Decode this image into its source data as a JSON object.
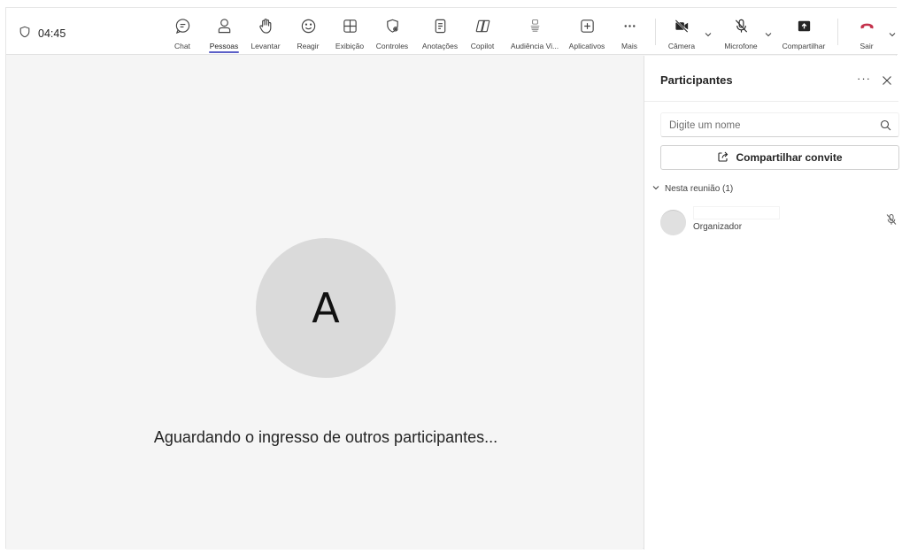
{
  "toolbar": {
    "timer": "04:45",
    "items": [
      {
        "label": "Chat",
        "icon": "chat-icon"
      },
      {
        "label": "Pessoas",
        "icon": "people-icon"
      },
      {
        "label": "Levantar",
        "icon": "raise-hand-icon"
      },
      {
        "label": "Reagir",
        "icon": "react-icon"
      },
      {
        "label": "Exibição",
        "icon": "view-icon"
      },
      {
        "label": "Controles",
        "icon": "controls-icon"
      },
      {
        "label": "Anotações",
        "icon": "notes-icon"
      },
      {
        "label": "Copilot",
        "icon": "copilot-icon"
      },
      {
        "label": "Audiência Vi...",
        "icon": "audience-icon"
      },
      {
        "label": "Aplicativos",
        "icon": "apps-icon"
      },
      {
        "label": "Mais",
        "icon": "more-icon"
      }
    ],
    "camera": "Câmera",
    "microphone": "Microfone",
    "share": "Compartilhar",
    "leave": "Sair"
  },
  "stage": {
    "avatar_initial": "A",
    "waiting_text": "Aguardando o ingresso de outros participantes..."
  },
  "panel": {
    "title": "Participantes",
    "more": "···",
    "search_placeholder": "Digite um nome",
    "share_invite": "Compartilhar convite",
    "section_label": "Nesta reunião (1)",
    "participants": [
      {
        "name": "",
        "role": "Organizador",
        "muted": true
      }
    ]
  },
  "colors": {
    "accent": "#5b5fc7",
    "leave_red": "#c4314b",
    "stage_bg": "#f5f5f5",
    "avatar_bg": "#dadada"
  }
}
